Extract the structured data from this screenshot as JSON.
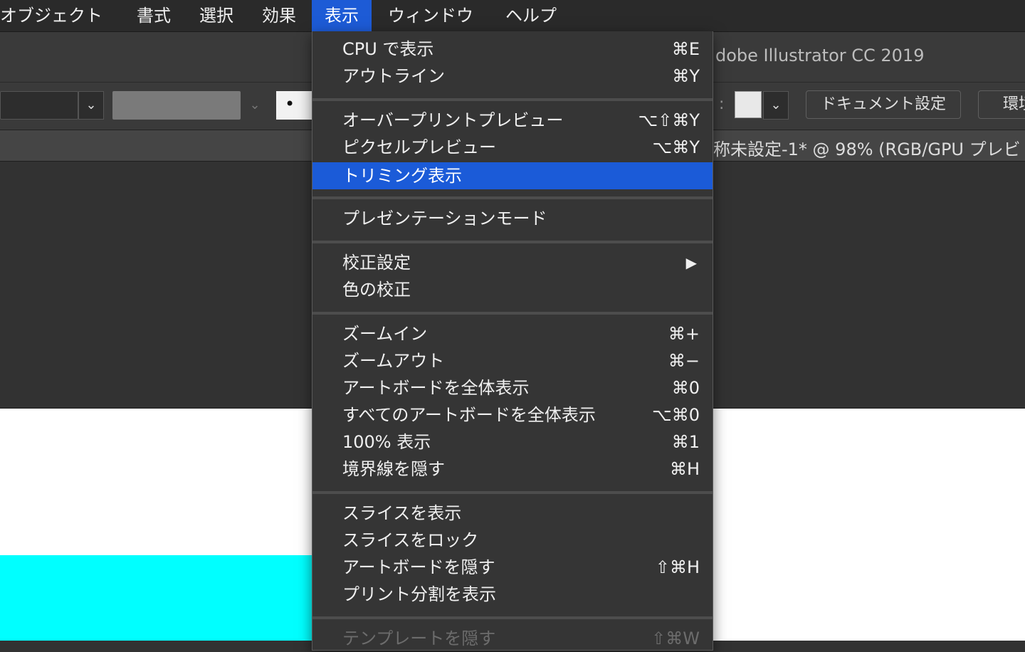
{
  "menubar": {
    "items": [
      {
        "label": "オブジェクト"
      },
      {
        "label": "書式"
      },
      {
        "label": "選択"
      },
      {
        "label": "効果"
      },
      {
        "label": "表示"
      },
      {
        "label": "ウィンドウ"
      },
      {
        "label": "ヘルプ"
      }
    ],
    "active_item": "表示"
  },
  "app": {
    "title": "dobe Illustrator CC 2019",
    "document_tab_title": "称未設定-1* @ 98% (RGB/GPU プレビ"
  },
  "control_bar": {
    "dot_label": "•",
    "colon": ":",
    "document_setup_label": "ドキュメント設定",
    "preferences_label": "環境",
    "chevron": "⌄"
  },
  "view_menu": {
    "items": [
      {
        "label": "CPU で表示",
        "shortcut": "⌘E"
      },
      {
        "label": "アウトライン",
        "shortcut": "⌘Y"
      },
      {
        "label": "オーバープリントプレビュー",
        "shortcut": "⌥⇧⌘Y"
      },
      {
        "label": "ピクセルプレビュー",
        "shortcut": "⌥⌘Y"
      },
      {
        "label": "トリミング表示",
        "shortcut": ""
      },
      {
        "label": "プレゼンテーションモード",
        "shortcut": ""
      },
      {
        "label": "校正設定",
        "shortcut": "",
        "submenu_arrow": "▶"
      },
      {
        "label": "色の校正",
        "shortcut": ""
      },
      {
        "label": "ズームイン",
        "shortcut": "⌘+"
      },
      {
        "label": "ズームアウト",
        "shortcut": "⌘−"
      },
      {
        "label": "アートボードを全体表示",
        "shortcut": "⌘0"
      },
      {
        "label": "すべてのアートボードを全体表示",
        "shortcut": "⌥⌘0"
      },
      {
        "label": "100% 表示",
        "shortcut": "⌘1"
      },
      {
        "label": "境界線を隠す",
        "shortcut": "⌘H"
      },
      {
        "label": "スライスを表示",
        "shortcut": ""
      },
      {
        "label": "スライスをロック",
        "shortcut": ""
      },
      {
        "label": "アートボードを隠す",
        "shortcut": "⇧⌘H"
      },
      {
        "label": "プリント分割を表示",
        "shortcut": ""
      },
      {
        "label": "テンプレートを隠す",
        "shortcut": "⇧⌘W"
      }
    ],
    "highlighted_item": "トリミング表示",
    "disabled_item": "テンプレートを隠す"
  },
  "colors": {
    "accent": "#1b5bd8",
    "artboard_object": "#00ffff"
  }
}
